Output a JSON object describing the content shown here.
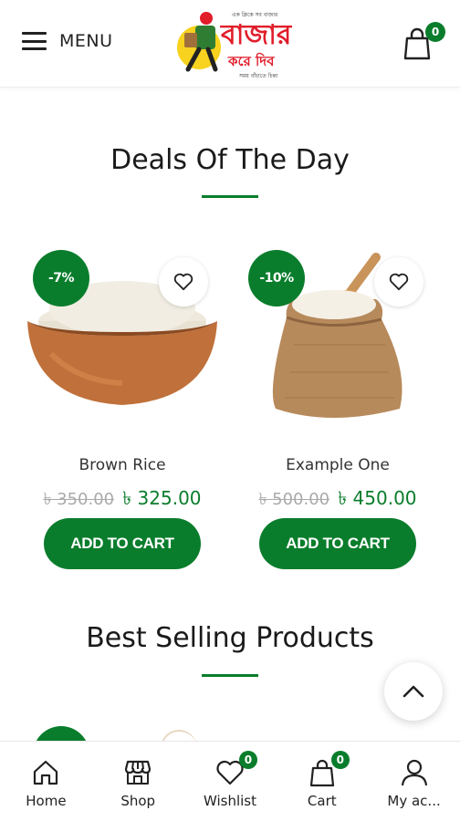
{
  "header": {
    "menu_label": "MENU",
    "cart_count": "0",
    "logo": {
      "tagline": "এক ক্লিকে সব বাজার",
      "word1": "বাজার",
      "word2": "করে দিব",
      "sub": "সময় বাঁচাতে চিন্তা"
    }
  },
  "deals": {
    "title": "Deals Of The Day",
    "products": [
      {
        "name": "Brown Rice",
        "discount": "-7%",
        "old_price": "৳ 350.00",
        "new_price": "৳ 325.00",
        "button": "ADD TO CART",
        "image_icon": "rice-bowl-image"
      },
      {
        "name": "Example One",
        "discount": "-10%",
        "old_price": "৳ 500.00",
        "new_price": "৳ 450.00",
        "button": "ADD TO CART",
        "image_icon": "rice-sack-image"
      }
    ]
  },
  "best_selling": {
    "title": "Best Selling Products"
  },
  "bottom_nav": [
    {
      "label": "Home",
      "icon": "home-icon"
    },
    {
      "label": "Shop",
      "icon": "shop-icon"
    },
    {
      "label": "Wishlist",
      "icon": "heart-icon",
      "count": "0"
    },
    {
      "label": "Cart",
      "icon": "cart-icon",
      "count": "0"
    },
    {
      "label": "My ac...",
      "icon": "user-icon"
    }
  ],
  "colors": {
    "accent": "#0a7d2c",
    "logo_red": "#e11d2a",
    "logo_yellow": "#f7d21f"
  }
}
